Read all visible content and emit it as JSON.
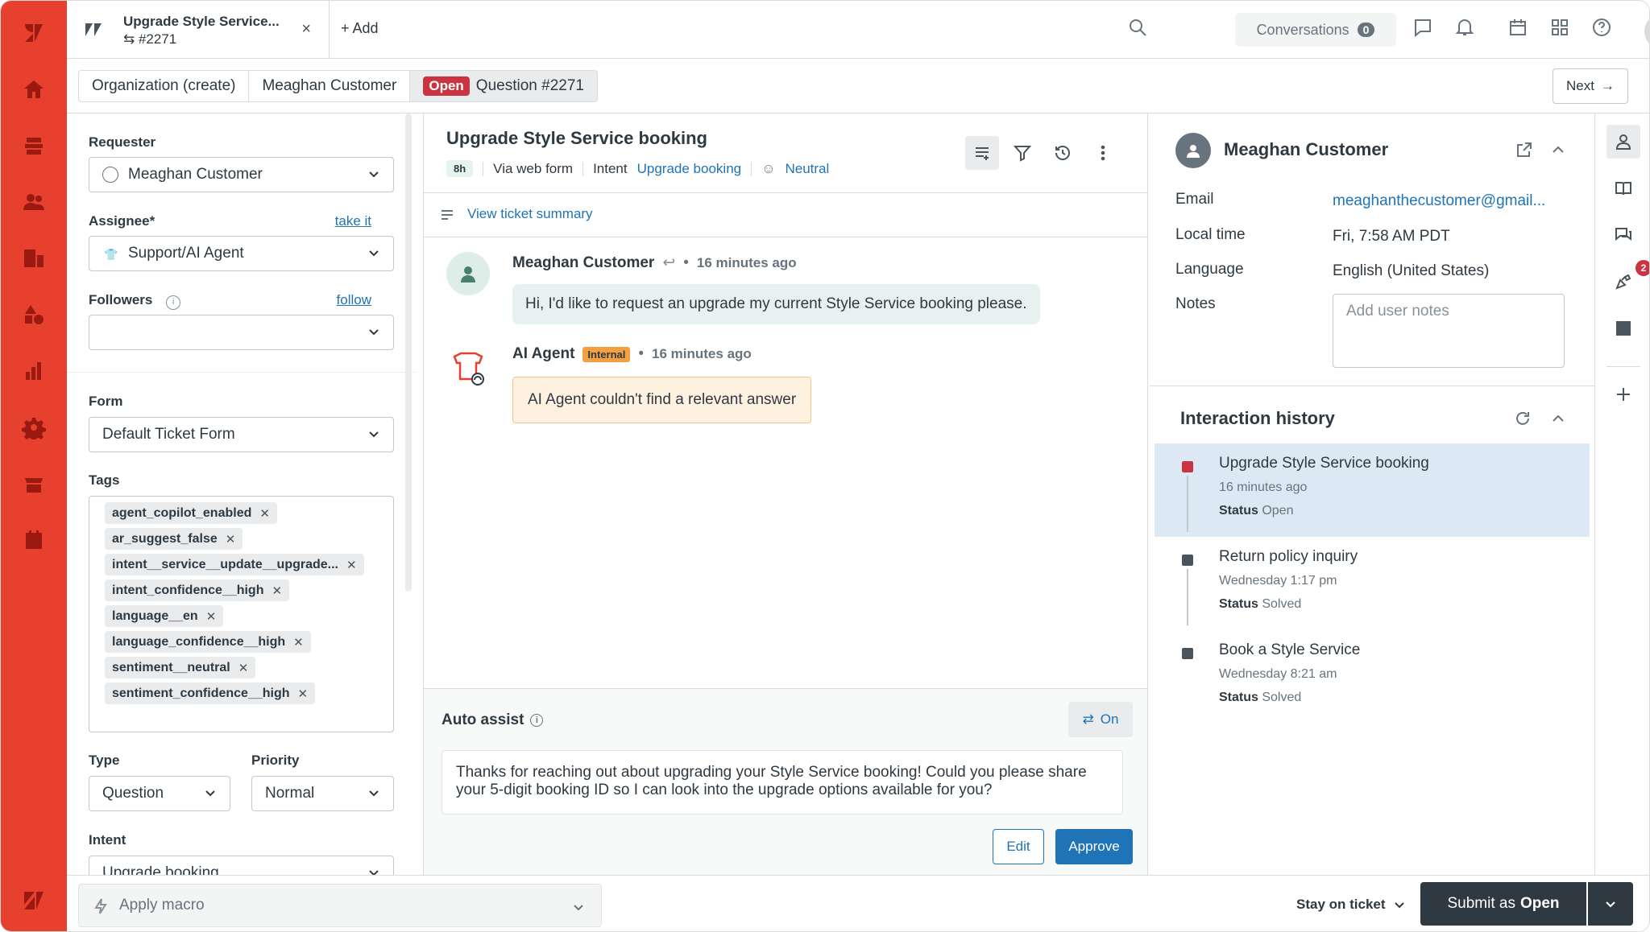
{
  "tab": {
    "title": "Upgrade Style Service...",
    "ticket_id": "#2271",
    "close": "×"
  },
  "add_label": "Add",
  "topbar": {
    "conversations_label": "Conversations",
    "conversations_count": "0"
  },
  "breadcrumbs": {
    "org": "Organization (create)",
    "customer": "Meaghan Customer",
    "status_badge": "Open",
    "ticket": "Question #2271",
    "next_label": "Next"
  },
  "props": {
    "requester_label": "Requester",
    "requester_value": "Meaghan Customer",
    "assignee_label": "Assignee*",
    "assignee_take": "take it",
    "assignee_value": "Support/AI Agent",
    "followers_label": "Followers",
    "followers_follow": "follow",
    "form_label": "Form",
    "form_value": "Default Ticket Form",
    "tags_label": "Tags",
    "tags": [
      "agent_copilot_enabled",
      "ar_suggest_false",
      "intent__service__update__upgrade...",
      "intent_confidence__high",
      "language__en",
      "language_confidence__high",
      "sentiment__neutral",
      "sentiment_confidence__high"
    ],
    "type_label": "Type",
    "type_value": "Question",
    "priority_label": "Priority",
    "priority_value": "Normal",
    "intent_label": "Intent",
    "intent_value": "Upgrade booking"
  },
  "ticket": {
    "subject": "Upgrade Style Service booking",
    "age_badge": "8h",
    "via": "Via web form",
    "intent_label": "Intent",
    "intent_value": "Upgrade booking",
    "sentiment": "Neutral",
    "summary_link": "View ticket summary"
  },
  "messages": [
    {
      "author": "Meaghan Customer",
      "time": "16 minutes ago",
      "body": "Hi, I'd like to request an upgrade my current Style Service booking please."
    },
    {
      "author": "AI Agent",
      "badge": "Internal",
      "time": "16 minutes ago",
      "body": "AI Agent couldn't find a relevant answer"
    }
  ],
  "auto_assist": {
    "title": "Auto assist",
    "toggle": "On",
    "suggestion": "Thanks for reaching out about upgrading your Style Service booking! Could you please share your 5-digit booking ID so I can look into the upgrade options available for you?",
    "edit": "Edit",
    "approve": "Approve"
  },
  "user": {
    "name": "Meaghan Customer",
    "email_label": "Email",
    "email": "meaghanthecustomer@gmail...",
    "localtime_label": "Local time",
    "localtime": "Fri, 7:58 AM PDT",
    "language_label": "Language",
    "language": "English (United States)",
    "notes_label": "Notes",
    "notes_placeholder": "Add user notes"
  },
  "history": {
    "title": "Interaction history",
    "items": [
      {
        "title": "Upgrade Style Service booking",
        "date": "16 minutes ago",
        "status_label": "Status",
        "status": "Open"
      },
      {
        "title": "Return policy inquiry",
        "date": "Wednesday 1:17 pm",
        "status_label": "Status",
        "status": "Solved"
      },
      {
        "title": "Book a Style Service",
        "date": "Wednesday 8:21 am",
        "status_label": "Status",
        "status": "Solved"
      }
    ]
  },
  "rail_badge": "2",
  "bottom": {
    "macro_placeholder": "Apply macro",
    "stay": "Stay on ticket",
    "submit_prefix": "Submit as",
    "submit_status": "Open"
  },
  "colors": {
    "brand": "#e8402f",
    "open": "#cc3340",
    "link": "#1f73b7",
    "submit": "#2f3941"
  }
}
